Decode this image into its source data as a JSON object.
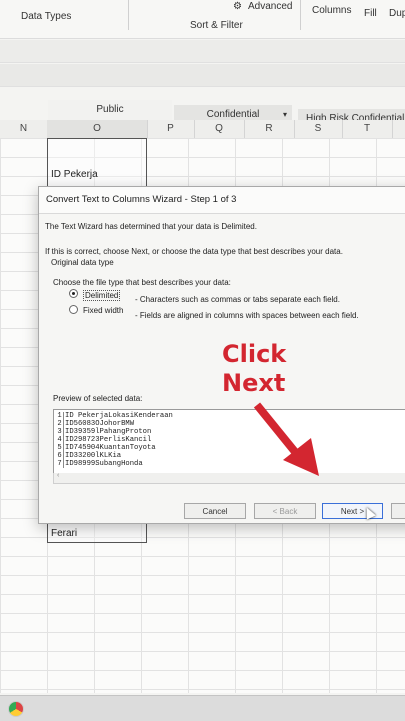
{
  "ribbon": {
    "data_types": "Data Types",
    "sort_filter": "Sort & Filter",
    "advanced": "Advanced",
    "columns": "Columns",
    "fill": "Fill",
    "dup": "Dup"
  },
  "labels": {
    "public": "Public",
    "confidential": "Confidential",
    "high_risk": "High Risk Confidential"
  },
  "columns": [
    "N",
    "O",
    "P",
    "Q",
    "R",
    "S",
    "T"
  ],
  "cells": {
    "o_header": "ID Pekerja",
    "o_bottom": "Ferari"
  },
  "dialog": {
    "title": "Convert Text to Columns Wizard - Step 1 of 3",
    "line1": "The Text Wizard has determined that your data is Delimited.",
    "line2": "If this is correct, choose Next, or choose the data type that best describes your data.",
    "group_label": "Original data type",
    "choose_label": "Choose the file type that best describes your data:",
    "options": [
      {
        "label": "Delimited",
        "desc": "- Characters such as commas or tabs separate each field.",
        "selected": true
      },
      {
        "label": "Fixed width",
        "desc": "- Fields are aligned in columns with spaces between each field.",
        "selected": false
      }
    ],
    "preview_label": "Preview of selected data:",
    "preview_rows": [
      {
        "n": "1",
        "text": "ID PekerjaLokasiKenderaan"
      },
      {
        "n": "2",
        "text": "ID56083OJohorBMW"
      },
      {
        "n": "3",
        "text": "ID39359lPahangProton"
      },
      {
        "n": "4",
        "text": "ID298723PerlisKancil"
      },
      {
        "n": "5",
        "text": "ID745904KuantanToyota"
      },
      {
        "n": "6",
        "text": "ID33200lKLKia"
      },
      {
        "n": "7",
        "text": "ID98999SubangHonda"
      }
    ],
    "buttons": {
      "cancel": "Cancel",
      "back": "< Back",
      "next": "Next >"
    }
  },
  "annotation": {
    "line1": "Click",
    "line2": "Next",
    "color": "#d32630"
  }
}
